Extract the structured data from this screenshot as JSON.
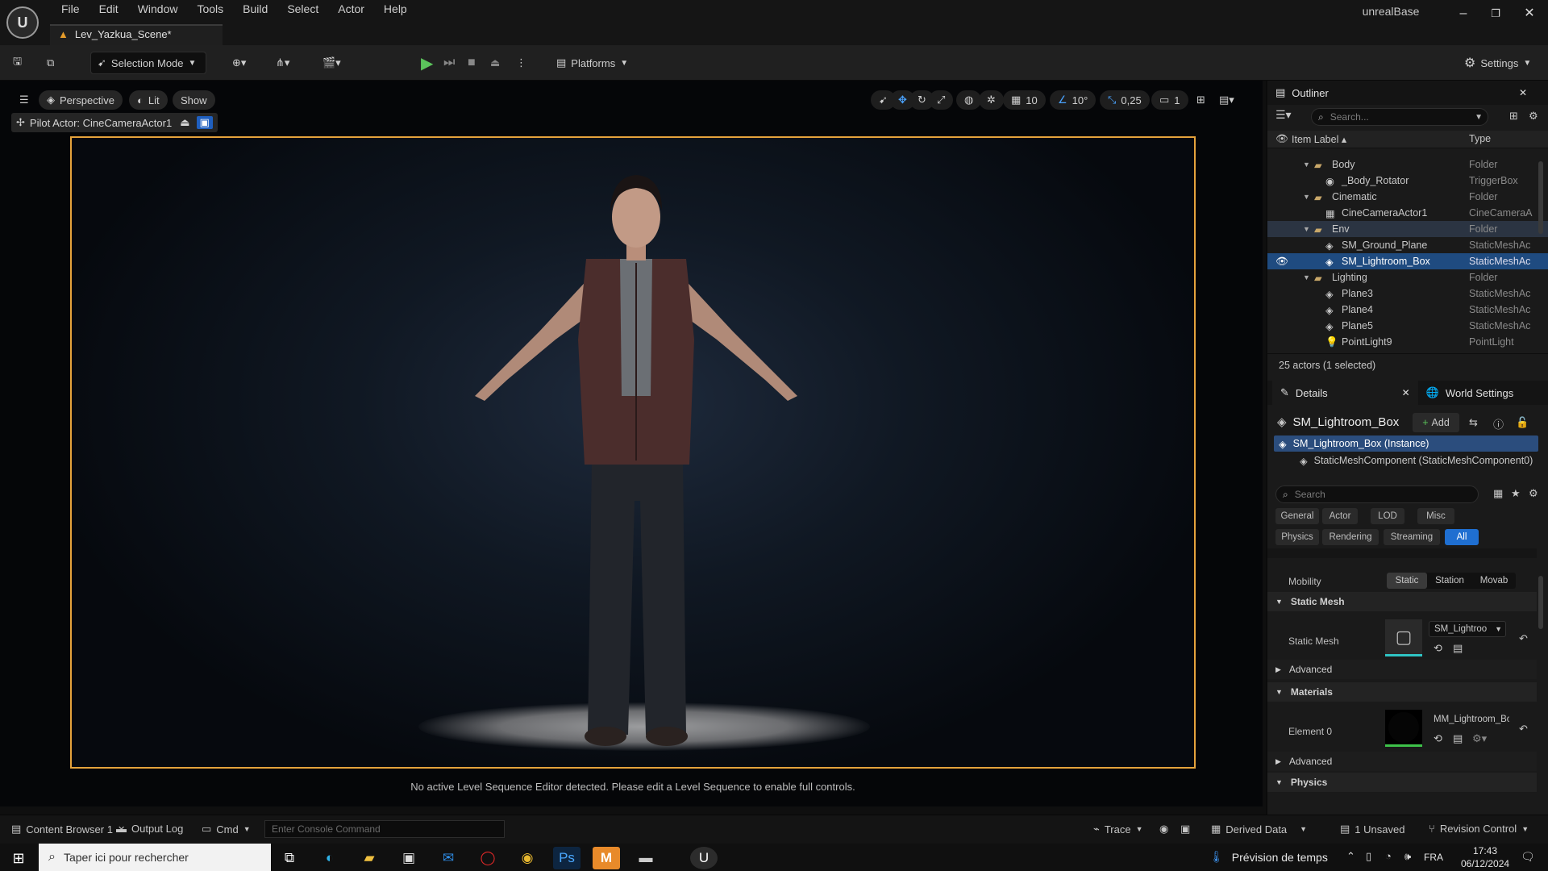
{
  "app": {
    "menu": [
      "File",
      "Edit",
      "Window",
      "Tools",
      "Build",
      "Select",
      "Actor",
      "Help"
    ],
    "project_name": "unrealBase",
    "level_tab": "Lev_Yazkua_Scene*"
  },
  "toolbar": {
    "selection_mode": "Selection Mode",
    "platforms": "Platforms",
    "settings": "Settings"
  },
  "viewport": {
    "perspective": "Perspective",
    "lit": "Lit",
    "show": "Show",
    "pilot_actor": "Pilot Actor: CineCameraActor1",
    "grid_snap": "10",
    "rotation_snap": "10°",
    "scale_snap": "0,25",
    "camera_speed": "1",
    "sequence_message": "No active Level Sequence Editor detected. Please edit a Level Sequence to enable full controls."
  },
  "outliner": {
    "title": "Outliner",
    "search_placeholder": "Search...",
    "col_label": "Item Label ▴",
    "col_type": "Type",
    "rows": [
      {
        "label": "Body",
        "type": "Folder"
      },
      {
        "label": "_Body_Rotator",
        "type": "TriggerBox"
      },
      {
        "label": "Cinematic",
        "type": "Folder"
      },
      {
        "label": "CineCameraActor1",
        "type": "CineCameraA"
      },
      {
        "label": "Env",
        "type": "Folder"
      },
      {
        "label": "SM_Ground_Plane",
        "type": "StaticMeshAc"
      },
      {
        "label": "SM_Lightroom_Box",
        "type": "StaticMeshAc"
      },
      {
        "label": "Lighting",
        "type": "Folder"
      },
      {
        "label": "Plane3",
        "type": "StaticMeshAc"
      },
      {
        "label": "Plane4",
        "type": "StaticMeshAc"
      },
      {
        "label": "Plane5",
        "type": "StaticMeshAc"
      },
      {
        "label": "PointLight9",
        "type": "PointLight"
      }
    ],
    "footer": "25 actors (1 selected)"
  },
  "details": {
    "tab_details": "Details",
    "tab_world": "World Settings",
    "object_name": "SM_Lightroom_Box",
    "add_label": "Add",
    "instance": "SM_Lightroom_Box (Instance)",
    "component": "StaticMeshComponent (StaticMeshComponent0)",
    "search_placeholder": "Search",
    "filters_row1": [
      "General",
      "Actor",
      "LOD",
      "Misc"
    ],
    "filters_row2": [
      "Physics",
      "Rendering",
      "Streaming",
      "All"
    ],
    "mobility_label": "Mobility",
    "mobility_options": [
      "Static",
      "Station",
      "Movab"
    ],
    "static_mesh_section": "Static Mesh",
    "static_mesh_label": "Static Mesh",
    "static_mesh_value": "SM_Lightroo",
    "advanced": "Advanced",
    "materials_section": "Materials",
    "element0_label": "Element 0",
    "element0_value": "MM_Lightroom_Bo",
    "advanced2": "Advanced",
    "physics_section": "Physics"
  },
  "statusbar": {
    "content_browser": "Content Browser 1",
    "output_log": "Output Log",
    "cmd": "Cmd",
    "console_placeholder": "Enter Console Command",
    "trace": "Trace",
    "derived_data": "Derived Data",
    "unsaved": "1 Unsaved",
    "revision_control": "Revision Control"
  },
  "taskbar": {
    "search_placeholder": "Taper ici pour rechercher",
    "weather": "Prévision de temps",
    "language": "FRA",
    "time": "17:43",
    "date": "06/12/2024"
  },
  "colors": {
    "accent_blue": "#1f4b80",
    "camera_frame": "#e5a33c",
    "play_green": "#5bc35b"
  }
}
